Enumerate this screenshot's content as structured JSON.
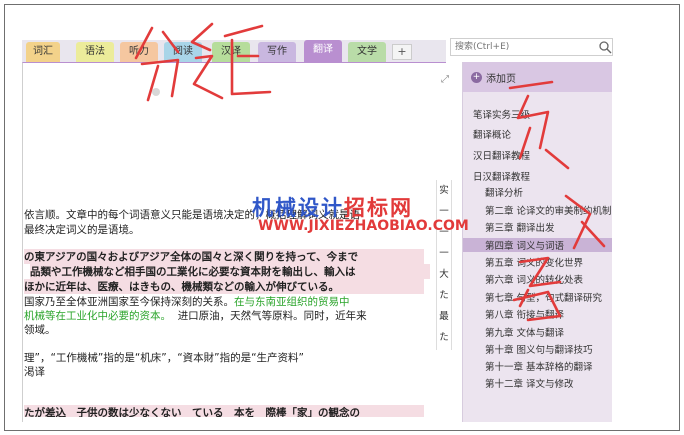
{
  "tabs": [
    {
      "label": "词汇",
      "color": "#f3d28a"
    },
    {
      "label": "语法",
      "color": "#ecec9a"
    },
    {
      "label": "听力",
      "color": "#f5c7a0"
    },
    {
      "label": "阅读",
      "color": "#a9d5e8"
    },
    {
      "label": "汉译",
      "color": "#b6dd9b"
    },
    {
      "label": "写作",
      "color": "#c9b7e0"
    },
    {
      "label": "翻译",
      "color": "#b98fd0"
    },
    {
      "label": "文学",
      "color": "#b9dca8"
    }
  ],
  "tab_add": "+",
  "search": {
    "placeholder": "搜索(Ctrl+E)"
  },
  "content_lines": [
    "依言顺。文章中的每个词语意义只能是语境决定的，概括理解词义就是语",
    "最终决定词义的是语境。",
    "の東アジアの国々およびアジア全体の国々と深く関りを持って、今まで",
    "品類や工作機械など相手国の工業化に必要な資本財を輸出し、輸入は",
    "ほかに近年は、医療、はきもの、機械類などの輸入が伸びている。",
    "国家乃至全体亚洲国家至今保持深刻的关系。",
    "在与东南亚组织的贸易中",
    "机械等在工业化中必要的资本。",
    "进口原油，天然气等原料。同时，近年来",
    "领域。",
    "理”，“工作機械”指的是“机床”，“資本財”指的是“生产资料”",
    "渇译",
    "たが差込　子供の数は少なくない　ている　本を　際棒「家」の観念の"
  ],
  "vertical_chars": [
    "实",
    "一",
    "一",
    "一",
    "大",
    "た",
    "最",
    "た"
  ],
  "panel": {
    "add_page": "添加页",
    "pages": [
      "笔译实务三级",
      "翻译概论",
      "汉日翻译教程",
      "日汉翻译教程",
      "翻译分析",
      "第二章 论译文的审美制约机制",
      "第三章 翻译出发",
      "第四章 词义与词语",
      "第五章 词义的变化世界",
      "第六章 词义的转化处表",
      "第七章 句型，句式翻译研究",
      "第八章 衔接与翻译",
      "第九章 文体与翻译",
      "第十章 图义句与翻译技巧",
      "第十一章 基本辞格的翻译",
      "第十二章 译文与修改"
    ]
  },
  "watermark": {
    "line1a": "机械设计",
    "line1b": "招标网",
    "line2": "WWW.JIXIEZHAOBIAO.COM"
  },
  "colors": {
    "accent": "#b98fd0",
    "panel": "#ece4ef",
    "ink": "#e23b3b",
    "watermark_blue": "#3057c8"
  }
}
